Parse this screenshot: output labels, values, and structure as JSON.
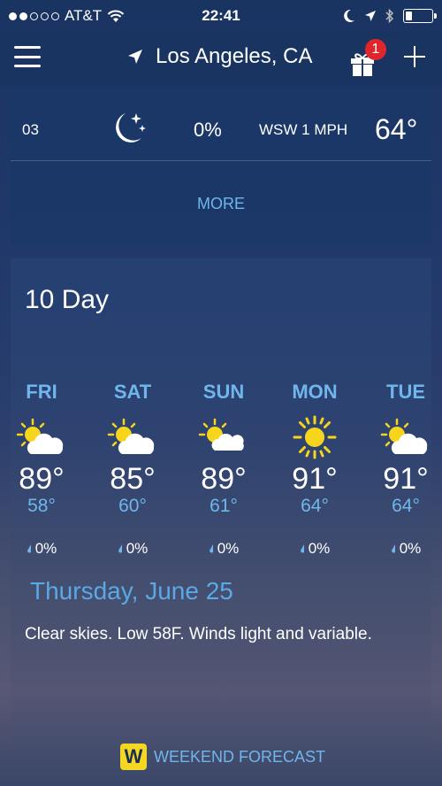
{
  "status_bar": {
    "carrier": "AT&T",
    "time": "22:41",
    "battery_level": 0.25
  },
  "header": {
    "location": "Los Angeles, CA",
    "gift_badge": "1"
  },
  "hourly": {
    "time": "03",
    "precip": "0%",
    "wind": "WSW 1 MPH",
    "temp": "64°",
    "more_label": "MORE",
    "icon": "moon-stars-icon"
  },
  "ten_day": {
    "title": "10 Day",
    "days": [
      {
        "name": "FRI",
        "high": "89°",
        "low": "58°",
        "precip": "0%",
        "icon": "partly-cloudy-icon"
      },
      {
        "name": "SAT",
        "high": "85°",
        "low": "60°",
        "precip": "0%",
        "icon": "partly-cloudy-icon"
      },
      {
        "name": "SUN",
        "high": "89°",
        "low": "61°",
        "precip": "0%",
        "icon": "partly-cloudy-icon"
      },
      {
        "name": "MON",
        "high": "91°",
        "low": "64°",
        "precip": "0%",
        "icon": "sunny-icon"
      },
      {
        "name": "TUE",
        "high": "91°",
        "low": "64°",
        "precip": "0%",
        "icon": "partly-cloudy-icon"
      }
    ],
    "narrative_date": "Thursday, June 25",
    "narrative_text": "Clear skies. Low 58F. Winds light and variable."
  },
  "weekend": {
    "icon_letter": "W",
    "label": "WEEKEND FORECAST"
  },
  "colors": {
    "accent": "#6fb6ec",
    "badge": "#e0262b",
    "sun": "#f7d51d"
  }
}
